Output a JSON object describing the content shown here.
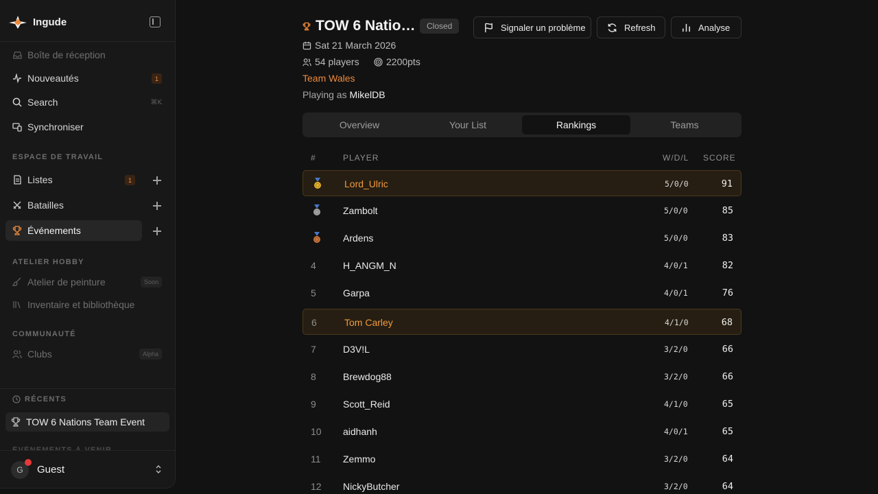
{
  "app": {
    "name": "Ingude"
  },
  "sidebar": {
    "inbox": "Boîte de réception",
    "news": "Nouveautés",
    "news_badge": "1",
    "search": "Search",
    "search_shortcut": "⌘K",
    "sync": "Synchroniser",
    "workspace_title": "ESPACE DE TRAVAIL",
    "lists": "Listes",
    "lists_badge": "1",
    "battles": "Batailles",
    "events": "Événements",
    "hobby_title": "ATELIER HOBBY",
    "paint": "Atelier de peinture",
    "paint_tag": "Soon",
    "inventory": "Inventaire et bibliothèque",
    "community_title": "COMMUNAUTÉ",
    "clubs": "Clubs",
    "clubs_tag": "Alpha",
    "recents_title": "RÉCENTS",
    "recent_item": "TOW 6 Nations Team Event",
    "upcoming_title": "ÉVÉNEMENTS À VENIR",
    "user": {
      "initial": "G",
      "name": "Guest"
    }
  },
  "event": {
    "title": "TOW 6 Natio…",
    "status": "Closed",
    "date": "Sat 21 March 2026",
    "players": "54 players",
    "points": "2200pts",
    "team": "Team Wales",
    "playing_prefix": "Playing as",
    "playing_as": "MikelDB"
  },
  "actions": {
    "report": "Signaler un problème",
    "refresh": "Refresh",
    "analyse": "Analyse"
  },
  "tabs": [
    "Overview",
    "Your List",
    "Rankings",
    "Teams"
  ],
  "active_tab": "Rankings",
  "table": {
    "headers": {
      "rank": "#",
      "player": "PLAYER",
      "wdl": "W/D/L",
      "score": "SCORE"
    },
    "rows": [
      {
        "rank": "1",
        "medal": "gold",
        "player": "Lord_Ulric",
        "wdl": "5/0/0",
        "score": "91",
        "highlight": true
      },
      {
        "rank": "2",
        "medal": "silver",
        "player": "Zambolt",
        "wdl": "5/0/0",
        "score": "85"
      },
      {
        "rank": "3",
        "medal": "bronze",
        "player": "Ardens",
        "wdl": "5/0/0",
        "score": "83"
      },
      {
        "rank": "4",
        "player": "H_ANGM_N",
        "wdl": "4/0/1",
        "score": "82"
      },
      {
        "rank": "5",
        "player": "Garpa",
        "wdl": "4/0/1",
        "score": "76"
      },
      {
        "rank": "6",
        "player": "Tom Carley",
        "wdl": "4/1/0",
        "score": "68",
        "highlight": true
      },
      {
        "rank": "7",
        "player": "D3V!L",
        "wdl": "3/2/0",
        "score": "66"
      },
      {
        "rank": "8",
        "player": "Brewdog88",
        "wdl": "3/2/0",
        "score": "66"
      },
      {
        "rank": "9",
        "player": "Scott_Reid",
        "wdl": "4/1/0",
        "score": "65"
      },
      {
        "rank": "10",
        "player": "aidhanh",
        "wdl": "4/0/1",
        "score": "65"
      },
      {
        "rank": "11",
        "player": "Zemmo",
        "wdl": "3/2/0",
        "score": "64"
      },
      {
        "rank": "12",
        "player": "NickyButcher",
        "wdl": "3/2/0",
        "score": "64"
      }
    ]
  },
  "colors": {
    "accent": "#ef8a3a",
    "highlight_bg": "#261e12",
    "gold": "#e3b12c",
    "silver": "#a9a9a9",
    "bronze": "#c7743a",
    "notif": "#e63a3a"
  }
}
